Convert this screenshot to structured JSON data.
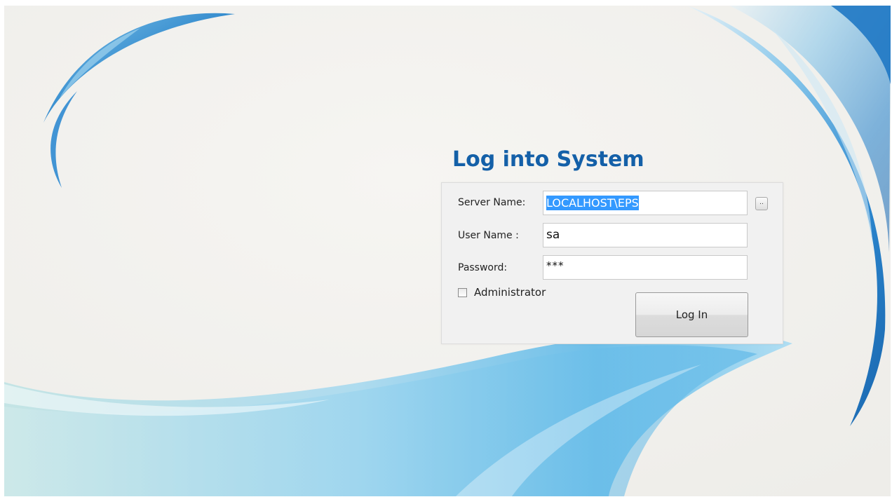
{
  "login": {
    "title": "Log into System",
    "server_label": "Server Name:",
    "server_value": "LOCALHOST\\EPS",
    "browse_label": "..",
    "user_label": "User Name :",
    "user_value": "sa",
    "password_label": "Password:",
    "password_value": "***",
    "admin_label": "Administrator",
    "admin_checked": false,
    "login_button": "Log In"
  },
  "colors": {
    "title": "#1460a8",
    "selection": "#3399ff",
    "swoosh_dark": "#1a78c8",
    "swoosh_light": "#7fc6ec",
    "background": "#f1f0ed"
  }
}
